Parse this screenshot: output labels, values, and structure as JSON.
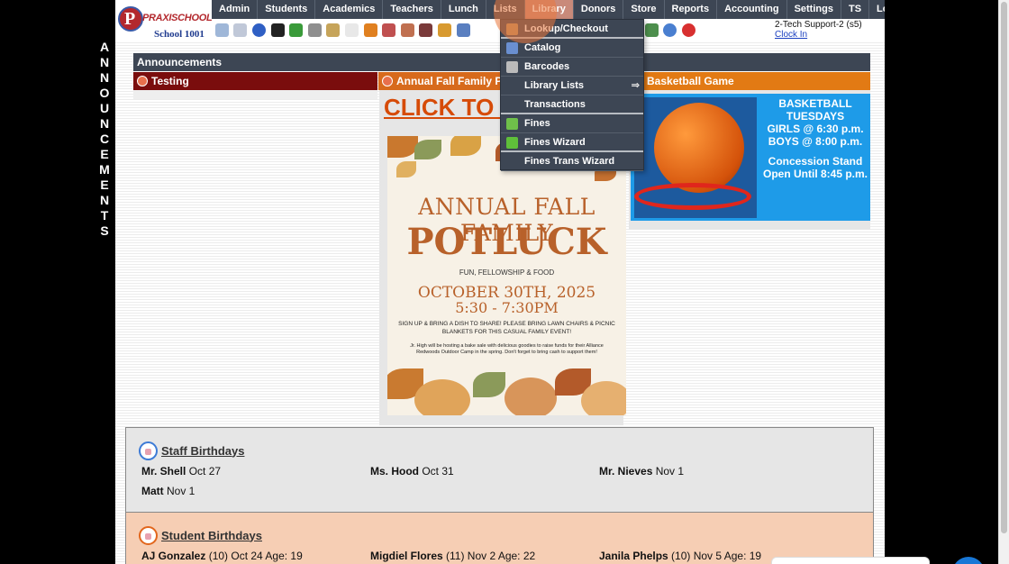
{
  "vertical_word": [
    "A",
    "N",
    "N",
    "O",
    "U",
    "N",
    "C",
    "E",
    "M",
    "E",
    "N",
    "T",
    "S"
  ],
  "logo": {
    "brand": "PRAXISCHOOL",
    "letter": "P",
    "school": "School 1001"
  },
  "nav": [
    "Admin",
    "Students",
    "Academics",
    "Teachers",
    "Lunch",
    "Lists",
    "Library",
    "Donors",
    "Store",
    "Reports",
    "Accounting",
    "Settings",
    "TS",
    "Logout"
  ],
  "user": {
    "name": "2-Tech Support-2 (s5)",
    "clock_in": "Clock In"
  },
  "toolbar_icons": [
    {
      "name": "search-icon",
      "color": "#9fb7d8"
    },
    {
      "name": "table-icon",
      "color": "#c0c8d8"
    },
    {
      "name": "email-icon",
      "color": "#2f5fc4"
    },
    {
      "name": "phone-icon",
      "color": "#222222"
    },
    {
      "name": "refresh-icon",
      "color": "#3a9b3a"
    },
    {
      "name": "speaker-icon",
      "color": "#8f8f8f"
    },
    {
      "name": "report-icon",
      "color": "#c6a45a"
    },
    {
      "name": "calendar-icon",
      "color": "#e8e8e8"
    },
    {
      "name": "megaphone-icon",
      "color": "#e08020"
    },
    {
      "name": "teacher-icon",
      "color": "#c05050"
    },
    {
      "name": "student-icon",
      "color": "#c07050"
    },
    {
      "name": "parents-icon",
      "color": "#7a3a3a"
    },
    {
      "name": "lunch-icon",
      "color": "#d89a30"
    },
    {
      "name": "book-icon",
      "color": "#5a7fc0"
    },
    {
      "name": "gold-icon",
      "color": "#e4b020"
    },
    {
      "name": "pdf-icon",
      "color": "#e03030"
    },
    {
      "name": "money-icon",
      "color": "#4d8f4d"
    },
    {
      "name": "help-icon",
      "color": "#4a7fd0"
    },
    {
      "name": "power-icon",
      "color": "#d83030"
    }
  ],
  "library_menu": [
    {
      "label": "Lookup/Checkout",
      "icon": "lookup-icon",
      "icon_color": "#b89060",
      "sep": true
    },
    {
      "label": "Catalog",
      "icon": "catalog-icon",
      "icon_color": "#6a8fd0",
      "sep": false
    },
    {
      "label": "Barcodes",
      "icon": "barcode-icon",
      "icon_color": "#bbbbbb",
      "sep": false
    },
    {
      "label": "Library Lists",
      "icon": "",
      "icon_color": "",
      "sep": false,
      "arrow": "⇒"
    },
    {
      "label": "Transactions",
      "icon": "",
      "icon_color": "",
      "sep": true
    },
    {
      "label": "Fines",
      "icon": "fines-icon",
      "icon_color": "#6fbf4a",
      "sep": false
    },
    {
      "label": "Fines Wizard",
      "icon": "dollar-icon",
      "icon_color": "#5fbf3a",
      "sep": true
    },
    {
      "label": "Fines Trans Wizard",
      "icon": "",
      "icon_color": "",
      "sep": false
    }
  ],
  "announcements": {
    "header": "Announcements",
    "col1_title": "Testing",
    "col2_title": "Annual Fall Family Po",
    "col3_title": "Basketball Game",
    "click_text": "CLICK TO S",
    "poster": {
      "title1": "ANNUAL FALL FAMILY",
      "title2": "POTLUCK",
      "sub": "FUN, FELLOWSHIP & FOOD",
      "date": "OCTOBER 30TH, 2025",
      "time": "5:30 - 7:30PM",
      "p1": "SIGN UP & BRING A DISH TO SHARE! PLEASE BRING LAWN CHAIRS & PICNIC BLANKETS FOR THIS CASUAL FAMILY EVENT!",
      "p2": "Jr. High will be hosting a bake sale with delicious goodies to raise funds for their Alliance Redwoods Outdoor Camp in the spring. Don't forget to bring cash to support them!"
    },
    "basketball": {
      "line1": "BASKETBALL",
      "line2": "TUESDAYS",
      "line3": "GIRLS @ 6:30 p.m.",
      "line4": "BOYS  @ 8:00 p.m.",
      "line5": "Concession Stand",
      "line6": "Open Until 8:45 p.m."
    }
  },
  "staff_birthdays": {
    "title": "Staff Birthdays",
    "entries": [
      {
        "name": "Mr. Shell",
        "date": "Oct 27"
      },
      {
        "name": "Ms. Hood",
        "date": "Oct 31"
      },
      {
        "name": "Mr. Nieves",
        "date": "Nov 1"
      },
      {
        "name": "Matt",
        "date": "Nov 1"
      }
    ]
  },
  "student_birthdays": {
    "title": "Student Birthdays",
    "entries": [
      {
        "name": "AJ Gonzalez",
        "detail": "(10) Oct 24 Age: 19"
      },
      {
        "name": "Migdiel Flores",
        "detail": "(11) Nov 2 Age: 22"
      },
      {
        "name": "Janila Phelps",
        "detail": "(10) Nov 5 Age: 19"
      }
    ]
  },
  "colors": {
    "nav_bg": "#3d4654",
    "nav_active": "#c98a7a",
    "testing_bg": "#7a0d0d",
    "potluck_bg": "#d76a1c",
    "basketball_bg": "#e27a14",
    "student_bday_bg": "#f6ceb4"
  }
}
